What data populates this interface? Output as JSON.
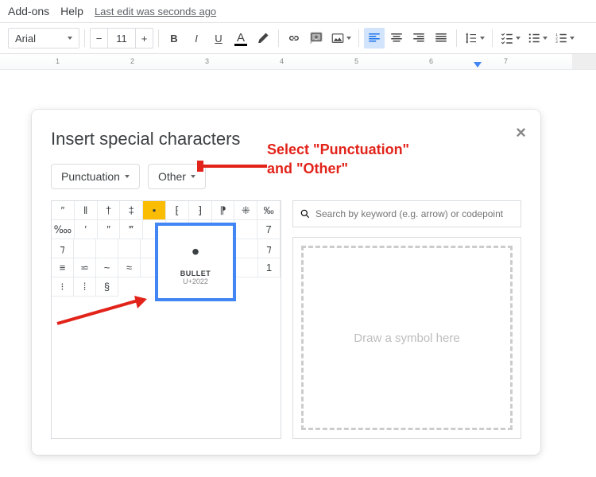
{
  "menubar": {
    "addons": "Add-ons",
    "help": "Help",
    "last_edit": "Last edit was seconds ago"
  },
  "toolbar": {
    "font": "Arial",
    "size": "11"
  },
  "ruler": {
    "numbers": [
      "1",
      "2",
      "3",
      "4",
      "5",
      "6",
      "7"
    ]
  },
  "dialog": {
    "title": "Insert special characters",
    "filter1": "Punctuation",
    "filter2": "Other",
    "search_placeholder": "Search by keyword (e.g. arrow) or codepoint",
    "draw_hint": "Draw a symbol here",
    "tooltip": {
      "char": "•",
      "name": "BULLET",
      "code": "U+2022"
    },
    "rows": {
      "r1": [
        "″",
        "‖",
        "†",
        "‡",
        "•",
        "⁅",
        "⁆",
        "⁋",
        "⁜",
        "‰"
      ],
      "r2": [
        "‱",
        "′",
        "″",
        "‴",
        "",
        "",
        "",
        "",
        "",
        "7"
      ],
      "r3": [
        "⁊",
        "",
        "",
        "",
        "",
        "",
        "⁊"
      ],
      "r4": [
        "≡",
        "⋍",
        "~",
        "≈",
        "",
        "",
        "1"
      ],
      "r5": [
        "⁝",
        "⁞",
        "§"
      ]
    }
  },
  "annotation": {
    "line1": "Select \"Punctuation\"",
    "line2": "and \"Other\""
  }
}
